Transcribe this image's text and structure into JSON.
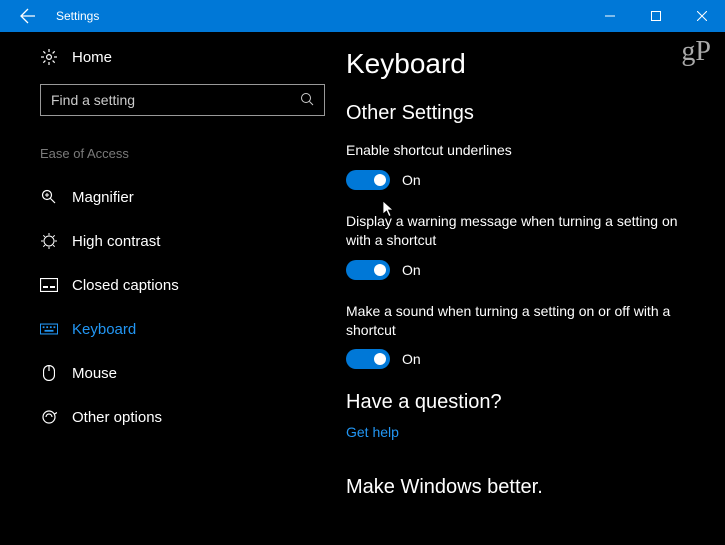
{
  "titlebar": {
    "title": "Settings"
  },
  "watermark": "gP",
  "sidebar": {
    "home": "Home",
    "search_placeholder": "Find a setting",
    "category": "Ease of Access",
    "items": [
      {
        "label": "Magnifier"
      },
      {
        "label": "High contrast"
      },
      {
        "label": "Closed captions"
      },
      {
        "label": "Keyboard"
      },
      {
        "label": "Mouse"
      },
      {
        "label": "Other options"
      }
    ]
  },
  "main": {
    "title": "Keyboard",
    "section": "Other Settings",
    "settings": [
      {
        "label": "Enable shortcut underlines",
        "state": "On"
      },
      {
        "label": "Display a warning message when turning a setting on with a shortcut",
        "state": "On"
      },
      {
        "label": "Make a sound when turning a setting on or off with a shortcut",
        "state": "On"
      }
    ],
    "question": "Have a question?",
    "help_link": "Get help",
    "better": "Make Windows better."
  }
}
